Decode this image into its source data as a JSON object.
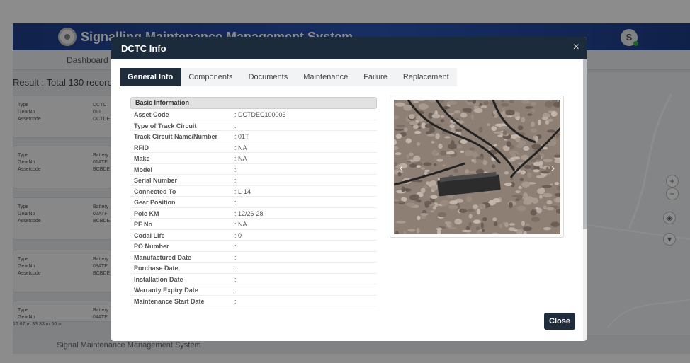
{
  "app": {
    "title": "Signalling Maintenance Management System",
    "avatar_letter": "S",
    "nav_dashboard": "Dashboard",
    "result_text": "Result : Total 130 records",
    "footer_text": "Signal Maintenance Management System",
    "scale_text": "16.67 m  33.33 m  50 m",
    "map_zoom_in": "+",
    "map_zoom_out": "−",
    "cards": [
      {
        "rows": [
          [
            "Type",
            "DCTC"
          ],
          [
            "GearNo",
            "01T"
          ],
          [
            "Assetcode",
            "DCTDE"
          ]
        ]
      },
      {
        "rows": [
          [
            "Type",
            "Battery"
          ],
          [
            "GearNo",
            "01ATF"
          ],
          [
            "Assetcode",
            "BCBDE"
          ]
        ]
      },
      {
        "rows": [
          [
            "Type",
            "Battery"
          ],
          [
            "GearNo",
            "02ATF"
          ],
          [
            "Assetcode",
            "BCBDE"
          ]
        ]
      },
      {
        "rows": [
          [
            "Type",
            "Battery"
          ],
          [
            "GearNo",
            "03ATF"
          ],
          [
            "Assetcode",
            "BCBDE"
          ]
        ]
      },
      {
        "rows": [
          [
            "Type",
            "Battery"
          ],
          [
            "GearNo",
            "04ATF"
          ]
        ]
      }
    ]
  },
  "modal": {
    "title": "DCTC Info",
    "close_icon": "×",
    "tabs": [
      {
        "label": "General Info",
        "active": true
      },
      {
        "label": "Components",
        "active": false
      },
      {
        "label": "Documents",
        "active": false
      },
      {
        "label": "Maintenance",
        "active": false
      },
      {
        "label": "Failure",
        "active": false
      },
      {
        "label": "Replacement",
        "active": false
      }
    ],
    "section_title": "Basic Information",
    "fields": [
      {
        "key": "Asset Code",
        "value": ": DCTDEC100003"
      },
      {
        "key": "Type of Track Circuit",
        "value": ":"
      },
      {
        "key": "Track Circuit Name/Number",
        "value": ": 01T"
      },
      {
        "key": "RFID",
        "value": ": NA"
      },
      {
        "key": "Make",
        "value": ": NA"
      },
      {
        "key": "Model",
        "value": ":"
      },
      {
        "key": "Serial Number",
        "value": ":"
      },
      {
        "key": "Connected To",
        "value": ": L-14"
      },
      {
        "key": "Gear Position",
        "value": ":"
      },
      {
        "key": "Pole KM",
        "value": ": 12/26-28"
      },
      {
        "key": "PF No",
        "value": ": NA"
      },
      {
        "key": "Codal Life",
        "value": ": 0"
      },
      {
        "key": "PO Number",
        "value": ":"
      },
      {
        "key": "Manufactured Date",
        "value": ":"
      },
      {
        "key": "Purchase Date",
        "value": ":"
      },
      {
        "key": "Installation Date",
        "value": ":"
      },
      {
        "key": "Warranty Expiry Date",
        "value": ":"
      },
      {
        "key": "Maintenance Start Date",
        "value": ":"
      }
    ],
    "photo_prev": "‹",
    "photo_next": "›",
    "close_button": "Close"
  }
}
